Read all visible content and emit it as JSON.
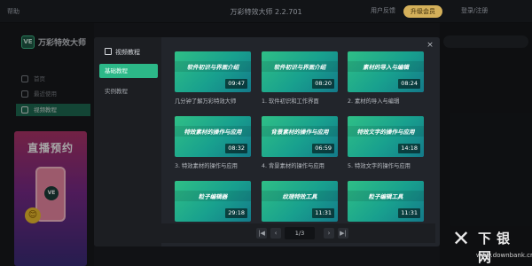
{
  "titlebar": {
    "help": "帮助",
    "title": "万彩特效大师 2.2.701",
    "messages": "用户反馈",
    "upgrade": "升级会员",
    "login": "登录/注册"
  },
  "sidebar": {
    "logo_badge": "VE",
    "logo_text": "万彩特效大师",
    "items": [
      {
        "label": "首页"
      },
      {
        "label": "最近使用"
      },
      {
        "label": "视频教程"
      }
    ],
    "promo": {
      "title": "直播预约",
      "badge": "VE",
      "emoji": "😊"
    }
  },
  "modal": {
    "close": "×",
    "header": "视频教程",
    "tabs": [
      {
        "label": "基础教程",
        "active": true
      },
      {
        "label": "实例教程",
        "active": false
      }
    ],
    "videos": [
      {
        "thumb_title": "软件初识与界面介绍",
        "duration": "09:47",
        "caption": "几分钟了解万彩特效大师"
      },
      {
        "thumb_title": "软件初识与界面介绍",
        "duration": "08:20",
        "caption": "1. 软件初识和工作界面"
      },
      {
        "thumb_title": "素材的导入与编辑",
        "duration": "08:24",
        "caption": "2. 素材的导入与编辑"
      },
      {
        "thumb_title": "特效素材的操作与应用",
        "duration": "08:32",
        "caption": "3. 特效素材的操作与应用"
      },
      {
        "thumb_title": "背景素材的操作与应用",
        "duration": "06:59",
        "caption": "4. 背景素材的操作与应用"
      },
      {
        "thumb_title": "特效文字的操作与应用",
        "duration": "14:18",
        "caption": "5. 特效文字的操作与应用"
      },
      {
        "thumb_title": "粒子编辑器",
        "duration": "29:18",
        "caption": ""
      },
      {
        "thumb_title": "纹理特效工具",
        "duration": "11:31",
        "caption": ""
      },
      {
        "thumb_title": "粒子编辑工具",
        "duration": "11:31",
        "caption": ""
      }
    ],
    "pagination": {
      "first": "|◀",
      "prev": "‹",
      "page": "1/3",
      "next": "›",
      "last": "▶|"
    }
  },
  "watermark": {
    "mark": "✕",
    "brand": "下银网",
    "url": "www.downbank.cn"
  }
}
